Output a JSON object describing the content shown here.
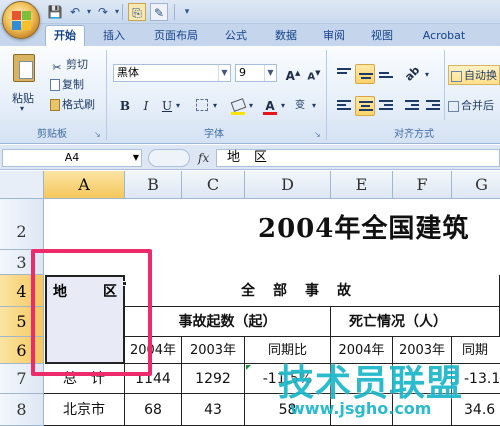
{
  "colors": {
    "accent": "#ee2b6a",
    "ribbon": "#dfe9f5",
    "tab_text": "#15428b",
    "watermark": "#19b6c9"
  },
  "quick_access": {
    "icons": [
      "save-icon",
      "undo-icon",
      "redo-icon",
      "print-preview-icon",
      "customize-icon"
    ]
  },
  "tabs": [
    {
      "label": "开始",
      "active": true
    },
    {
      "label": "插入"
    },
    {
      "label": "页面布局"
    },
    {
      "label": "公式"
    },
    {
      "label": "数据"
    },
    {
      "label": "审阅"
    },
    {
      "label": "视图"
    },
    {
      "label": "Acrobat"
    }
  ],
  "ribbon": {
    "clipboard": {
      "paste": "粘贴",
      "cut": "剪切",
      "copy": "复制",
      "format_painter": "格式刷",
      "label": "剪贴板"
    },
    "font": {
      "name": "黑体",
      "size": "9",
      "bold": "B",
      "italic": "I",
      "underline": "U",
      "grow": "A",
      "shrink": "A",
      "wen": "变",
      "label": "字体"
    },
    "alignment": {
      "label": "对齐方式",
      "wrap": "自动换",
      "merge": "合并后"
    }
  },
  "formula_bar": {
    "name_box": "A4",
    "fx": "fx",
    "content": "地区"
  },
  "columns": [
    "A",
    "B",
    "C",
    "D",
    "E",
    "F",
    "G"
  ],
  "rows": [
    "2",
    "3",
    "4",
    "5",
    "6",
    "7",
    "8"
  ],
  "sheet": {
    "title": "2004年全国建筑",
    "a4_left": "地",
    "a4_right": "区",
    "header_all": "全　部　事　故",
    "header_count": "事故起数（起）",
    "header_death": "死亡情况（人）",
    "sub_2004_b": "2004年",
    "sub_2003_c": "2003年",
    "sub_yoy_d": "同期比",
    "sub_2004_e": "2004年",
    "sub_2003_f": "2003年",
    "sub_yoy_g": "同期",
    "row7": {
      "a": "总　计",
      "b": "1144",
      "c": "1292",
      "d": "-11.5%",
      "g": "-13.1"
    },
    "row8": {
      "a": "北京市",
      "b": "68",
      "c": "43",
      "d": "58",
      "g": "34.6"
    }
  },
  "watermark": {
    "text": "技术员联盟",
    "url": "www.jsgho.com"
  }
}
